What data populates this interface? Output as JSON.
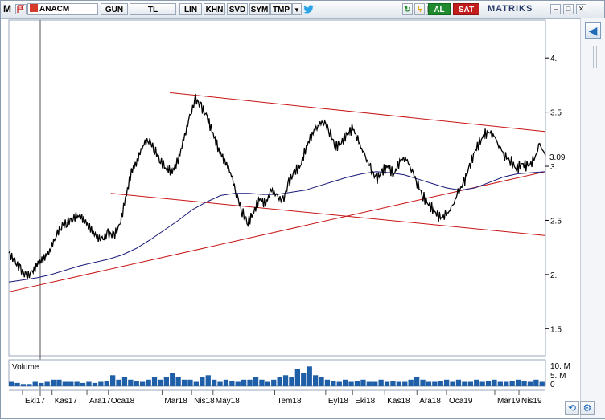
{
  "toolbar": {
    "app_letter": "M",
    "symbol": "ANACM",
    "buttons": [
      "GUN",
      "TL",
      "LIN",
      "KHN",
      "SVD",
      "SYM",
      "TMP"
    ],
    "al_label": "AL",
    "sat_label": "SAT",
    "brand": "MATRIKS",
    "colors": {
      "al": "#1f8a2e",
      "sat": "#c21d1d"
    }
  },
  "icons": [
    "flag-icon",
    "dropdown-icon",
    "twitter-icon",
    "refresh-icon",
    "lightning-icon",
    "minimize-icon",
    "maximize-icon",
    "close-icon",
    "back-arrow-icon",
    "sync-icon",
    "settings-icon"
  ],
  "chart_data": {
    "type": "line",
    "series_colors": {
      "price": "#000000",
      "moving_average": "#1a1a7a",
      "trend_lines": "#c81414"
    },
    "y_ticks": [
      "4.",
      "3.5",
      "3.",
      "2.5",
      "2.",
      "1.5"
    ],
    "ylim": [
      1.25,
      4.35
    ],
    "last_value_label": "3.09",
    "x_ticks": [
      "Eki17",
      "Kas17",
      "Ara17",
      "Oca18",
      "Mar18",
      "Nis18",
      "May18",
      "Tem18",
      "Eyl18",
      "Eki18",
      "Kas18",
      "Ara18",
      "Oca19",
      "Mar19",
      "Nis19"
    ],
    "price": [
      2.2,
      2.12,
      2.05,
      1.98,
      2.02,
      2.1,
      2.15,
      2.22,
      2.35,
      2.45,
      2.48,
      2.52,
      2.55,
      2.5,
      2.42,
      2.35,
      2.32,
      2.38,
      2.36,
      2.45,
      2.7,
      2.95,
      3.05,
      3.2,
      3.25,
      3.15,
      3.05,
      2.98,
      2.95,
      3.05,
      3.25,
      3.45,
      3.62,
      3.55,
      3.45,
      3.3,
      3.15,
      3.05,
      2.95,
      2.75,
      2.58,
      2.48,
      2.58,
      2.7,
      2.65,
      2.78,
      2.72,
      2.68,
      2.85,
      2.95,
      3.0,
      3.18,
      3.3,
      3.38,
      3.42,
      3.32,
      3.18,
      3.22,
      3.3,
      3.35,
      3.22,
      3.1,
      2.98,
      2.88,
      2.95,
      3.0,
      2.92,
      3.05,
      3.08,
      2.98,
      2.85,
      2.72,
      2.65,
      2.58,
      2.52,
      2.55,
      2.62,
      2.75,
      2.85,
      3.0,
      3.15,
      3.25,
      3.32,
      3.3,
      3.2,
      3.1,
      3.05,
      2.98,
      3.02,
      3.0,
      3.05,
      3.2,
      3.1
    ],
    "moving_average": [
      1.93,
      1.95,
      1.97,
      2.0,
      2.04,
      2.08,
      2.11,
      2.14,
      2.18,
      2.24,
      2.32,
      2.41,
      2.5,
      2.6,
      2.67,
      2.73,
      2.75,
      2.75,
      2.74,
      2.74,
      2.76,
      2.78,
      2.82,
      2.86,
      2.9,
      2.93,
      2.95,
      2.94,
      2.92,
      2.88,
      2.84,
      2.8,
      2.78,
      2.8,
      2.85,
      2.9,
      2.93,
      2.94,
      2.95
    ],
    "trend_lines": [
      {
        "x0": 0,
        "y0": 1.84,
        "x1": 1,
        "y1": 2.95
      },
      {
        "x0": 0.19,
        "y0": 2.75,
        "x1": 1,
        "y1": 2.36
      },
      {
        "x0": 0.3,
        "y0": 3.68,
        "x1": 1,
        "y1": 3.32
      }
    ],
    "volume_label": "Volume",
    "volume_ticks": [
      "10. M",
      "5. M",
      "0"
    ],
    "volume_max": 12,
    "volume": [
      2,
      1.5,
      1,
      1,
      2,
      1.5,
      2,
      3,
      3,
      2,
      2,
      2,
      1.5,
      2,
      1.5,
      2,
      2.5,
      5,
      3,
      4,
      3,
      2.5,
      2,
      3,
      4,
      3,
      4,
      6,
      4,
      3,
      3,
      2,
      4,
      5,
      3,
      2,
      3,
      2.5,
      2,
      3,
      3,
      4,
      3,
      2,
      3,
      4,
      5,
      4,
      8,
      6,
      9,
      5,
      4,
      3,
      2.5,
      2,
      3,
      2,
      2.5,
      3,
      2,
      2,
      3,
      2,
      2.5,
      2,
      2,
      3,
      4,
      3,
      2,
      2,
      2.5,
      3,
      2,
      3,
      2,
      2,
      3,
      2,
      2.5,
      3,
      2,
      2,
      2.5,
      3,
      2.5,
      2,
      3,
      2
    ]
  }
}
